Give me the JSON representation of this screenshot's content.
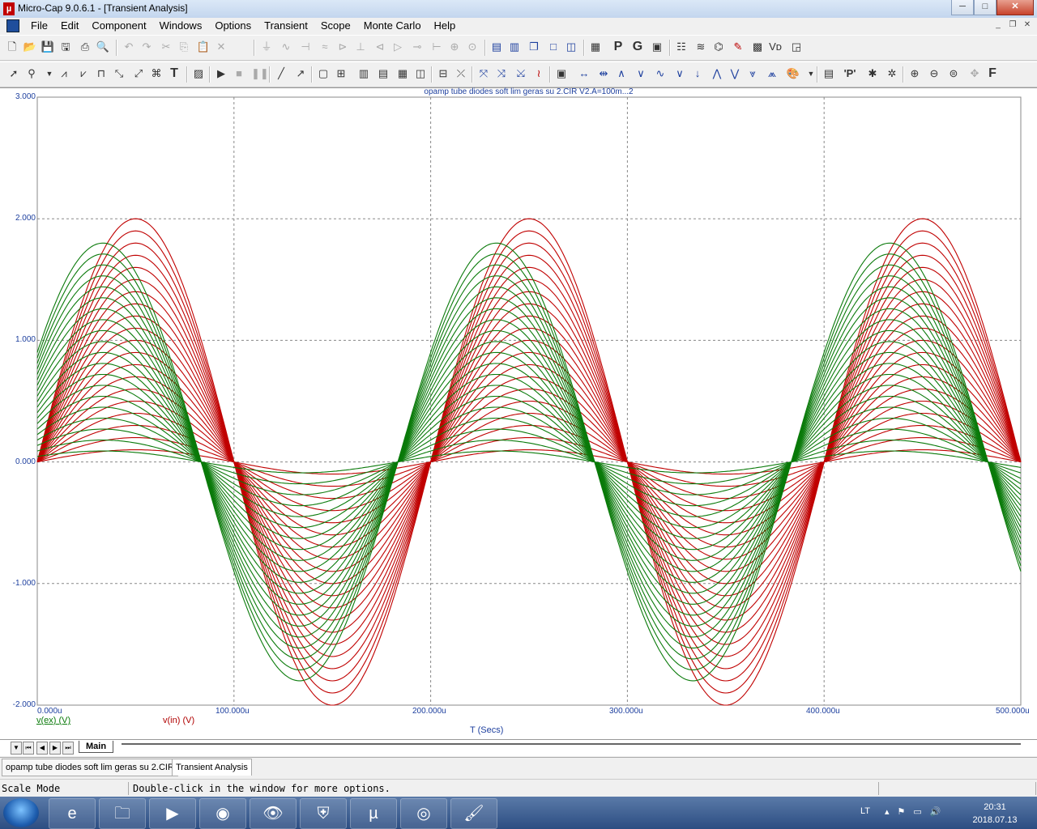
{
  "window": {
    "title": "Micro-Cap 9.0.6.1 - [Transient Analysis]",
    "buttons": {
      "minimize": "─",
      "maximize": "□",
      "close": "✕"
    }
  },
  "menu": [
    "File",
    "Edit",
    "Component",
    "Windows",
    "Options",
    "Transient",
    "Scope",
    "Monte Carlo",
    "Help"
  ],
  "plot": {
    "title": "opamp tube diodes soft lim geras su 2.CIR V2.A=100m...2",
    "legend": [
      {
        "label": "v(ex) (V)",
        "color": "#0a7a0a"
      },
      {
        "label": "v(in) (V)",
        "color": "#c00000"
      }
    ],
    "x_axis_label": "T (Secs)"
  },
  "chart_data": {
    "type": "line",
    "x_ticks": [
      "0.000u",
      "100.000u",
      "200.000u",
      "300.000u",
      "400.000u",
      "500.000u"
    ],
    "y_ticks": [
      "3.000",
      "2.000",
      "1.000",
      "0.000",
      "-1.000",
      "-2.000"
    ],
    "xlim": [
      0,
      0.0005
    ],
    "ylim": [
      -2,
      3
    ],
    "grid": true,
    "x_unit": "Secs",
    "sweep": {
      "param": "V2.A",
      "from": 0.1,
      "to": 2.0,
      "steps": 20
    },
    "series": [
      {
        "name": "v(in) (V)",
        "color": "#c00000",
        "kind": "sine",
        "frequency_hz": 5000,
        "amplitudes": [
          0.1,
          0.2,
          0.3,
          0.4,
          0.5,
          0.6,
          0.7,
          0.8,
          0.9,
          1.0,
          1.1,
          1.2,
          1.3,
          1.4,
          1.5,
          1.6,
          1.7,
          1.8,
          1.9,
          2.0
        ],
        "phase_deg": 0
      },
      {
        "name": "v(ex) (V)",
        "color": "#0a7a0a",
        "kind": "sine",
        "frequency_hz": 5000,
        "amplitudes": [
          0.09,
          0.18,
          0.27,
          0.36,
          0.45,
          0.54,
          0.63,
          0.72,
          0.81,
          0.9,
          0.99,
          1.08,
          1.17,
          1.26,
          1.35,
          1.44,
          1.53,
          1.62,
          1.71,
          1.8
        ],
        "phase_deg": 30
      }
    ]
  },
  "page_tab": "Main",
  "doc_tabs": [
    "opamp tube diodes soft lim geras su 2.CIR",
    "Transient Analysis"
  ],
  "status": {
    "mode": "Scale Mode",
    "message": "Double-click in the window for more options."
  },
  "taskbar": {
    "language": "LT",
    "time": "20:31",
    "date": "2018.07.13",
    "apps": [
      "ie-icon",
      "explorer-icon",
      "media-player-icon",
      "firefox-icon",
      "eye-app-icon",
      "shield-app-icon",
      "utorrent-icon",
      "micro-cap-icon",
      "paint-icon"
    ]
  }
}
